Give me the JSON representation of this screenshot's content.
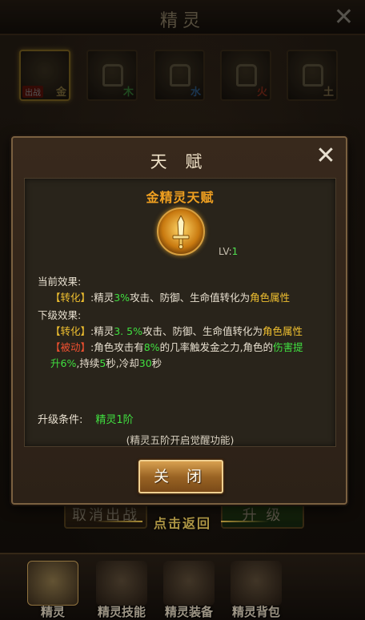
{
  "header": {
    "title": "精灵",
    "close_icon": "close-icon"
  },
  "avatars": [
    {
      "element": "金",
      "element_color": "#f0d070",
      "tag": "出战",
      "selected": true,
      "locked": false
    },
    {
      "element": "木",
      "element_color": "#60e060",
      "locked": true
    },
    {
      "element": "水",
      "element_color": "#50a0f0",
      "locked": true
    },
    {
      "element": "火",
      "element_color": "#f05030",
      "locked": true
    },
    {
      "element": "土",
      "element_color": "#e0c080",
      "locked": true
    }
  ],
  "background_buttons": {
    "cancel": "取消出战",
    "upgrade": "升 级",
    "back": "点击返回"
  },
  "nav": [
    {
      "label": "精灵",
      "active": true
    },
    {
      "label": "精灵技能"
    },
    {
      "label": "精灵装备"
    },
    {
      "label": "精灵背包"
    }
  ],
  "modal": {
    "title": "天 赋",
    "talent_name": "金精灵天赋",
    "level_label": "LV:",
    "level_value": "1",
    "current_label": "当前效果:",
    "current": {
      "tag": "【转化】",
      "pre": ":精灵",
      "percent": "3%",
      "post": "攻击、防御、生命值转化为",
      "target": "角色属性"
    },
    "next_label": "下级效果:",
    "next": {
      "tag": "【转化】",
      "pre": ":精灵",
      "percent": "3. 5%",
      "post": "攻击、防御、生命值转化为",
      "target": "角色属性"
    },
    "passive": {
      "tag": "【被动】",
      "pre": ":角色攻击有",
      "percent": "8%",
      "mid": "的几率触发金之力,角色的",
      "buff_a": "伤害提",
      "buff_b": "升6%",
      "dur_pre": ",持续",
      "duration": "5",
      "dur_unit": "秒,冷却",
      "cooldown": "30",
      "cd_unit": "秒"
    },
    "upgrade_label": "升级条件:",
    "upgrade_value": "精灵1阶",
    "note": "(精灵五阶开启觉醒功能)",
    "close_button": "关 闭"
  },
  "colors": {
    "accent_gold": "#f0a020",
    "green": "#40e040",
    "yellow": "#f0c030",
    "red": "#f05030"
  }
}
